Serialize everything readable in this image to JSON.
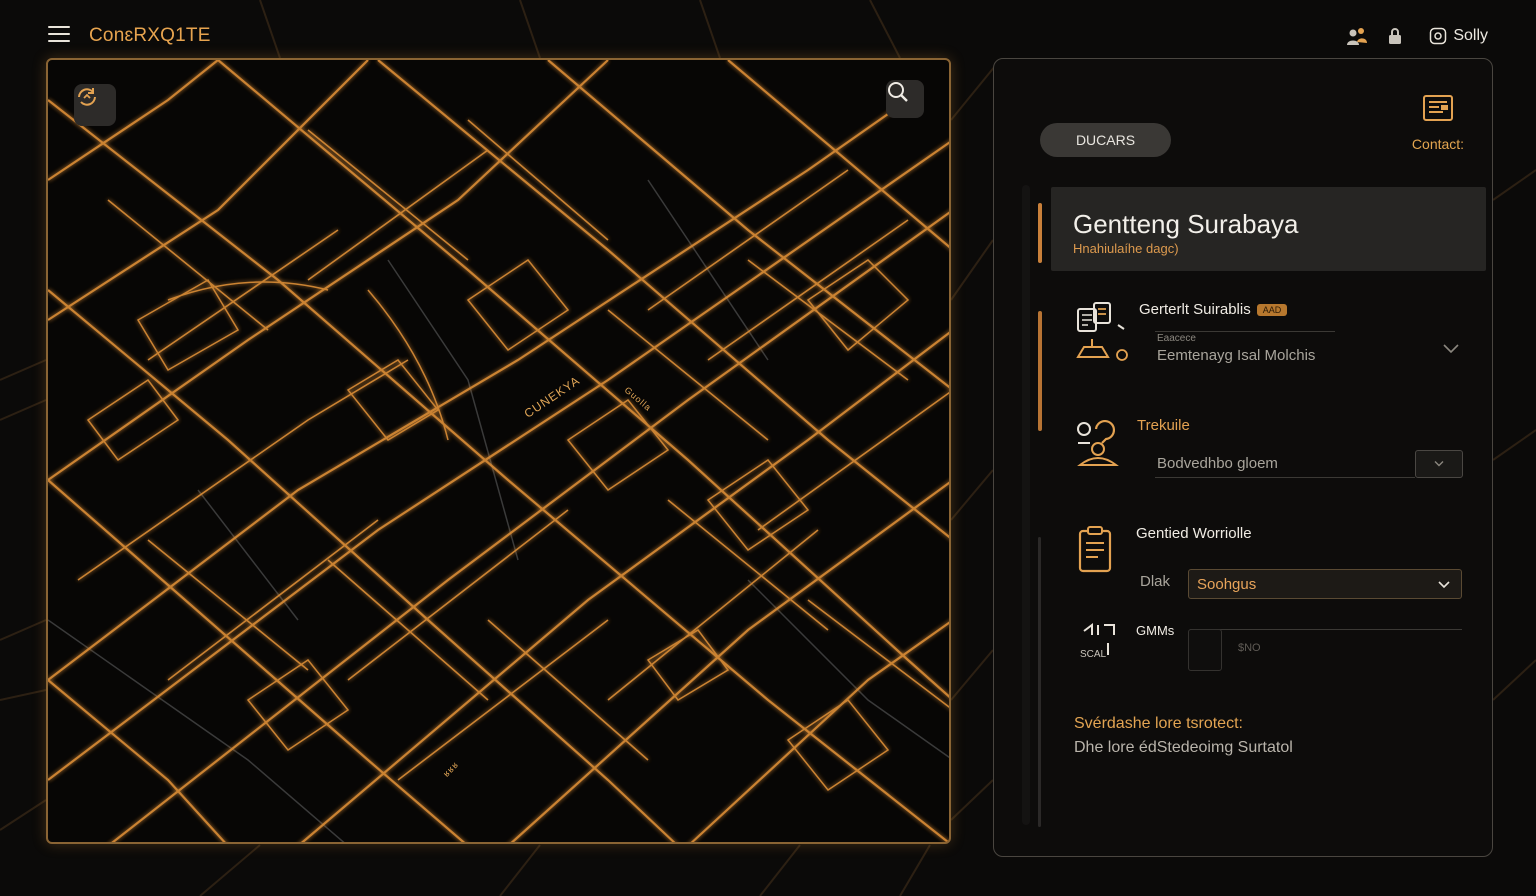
{
  "app": {
    "title": "ConɛRXQ1TE"
  },
  "header": {
    "icons": [
      "group-icon",
      "lock-icon",
      "circle-icon"
    ],
    "user_name": "Solly"
  },
  "map": {
    "street_labels": [
      "CUNEKYA",
      "Guolla",
      "ʁʁʁ"
    ],
    "buttons": [
      "refresh-icon",
      "search-icon"
    ]
  },
  "panel": {
    "pill_button": "DUCARS",
    "contact_label": "Contact:",
    "location": {
      "title": "Gentteng Surabaya",
      "subtitle": "Hnahiulaíhe dagc)"
    },
    "sections": [
      {
        "title": "Gerterlt Suirablis",
        "badge": "AAD",
        "field_label": "Eaacece",
        "field_value": "Eemtenayg Isal Molchis"
      },
      {
        "title": "Trekuile",
        "field_value": "Bodvedhbo gloem",
        "mini_select": "v"
      },
      {
        "title": "Gentied Worriolle",
        "field_label": "Dlak",
        "select_value": "Soohgus"
      },
      {
        "title": "GMMs",
        "icon_caption": "SCAL",
        "input_placeholder": "$NO"
      }
    ],
    "footer": {
      "title": "Svérdashe lore tsrotect:",
      "text": "Dhe lore édStedeoimg Surtatol"
    }
  },
  "colors": {
    "accent": "#e3a251",
    "background": "#0b0a09",
    "panel_bg": "#0d0c0b",
    "header_bg": "#262523"
  }
}
